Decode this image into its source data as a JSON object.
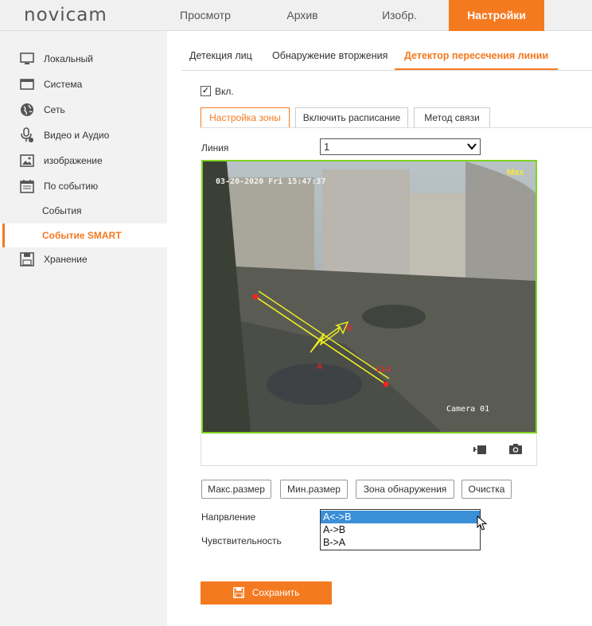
{
  "brand": {
    "logo": "novicam"
  },
  "topnav": [
    {
      "label": "Просмотр"
    },
    {
      "label": "Архив"
    },
    {
      "label": "Изобр."
    },
    {
      "label": "Настройки",
      "active": true
    }
  ],
  "sidebar": {
    "items": [
      {
        "label": "Локальный",
        "icon": "monitor-icon"
      },
      {
        "label": "Система",
        "icon": "window-icon"
      },
      {
        "label": "Сеть",
        "icon": "globe-icon"
      },
      {
        "label": "Видео и Аудио",
        "icon": "microphone-icon"
      },
      {
        "label": "изображение",
        "icon": "picture-icon"
      },
      {
        "label": "По событию",
        "icon": "calendar-icon"
      },
      {
        "label": "События"
      },
      {
        "label": "Событие SMART",
        "active": true
      },
      {
        "label": "Хранение",
        "icon": "floppy-icon"
      }
    ]
  },
  "tabs": [
    {
      "label": "Детекция лиц"
    },
    {
      "label": "Обнаружение вторжения"
    },
    {
      "label": "Детектор пересечения линии",
      "active": true
    }
  ],
  "enable": {
    "label": "Вкл.",
    "checked": true
  },
  "subtabs": [
    {
      "label": "Настройка зоны",
      "active": true
    },
    {
      "label": "Включить расписание"
    },
    {
      "label": "Метод связи"
    }
  ],
  "line": {
    "label": "Линия",
    "value": "1"
  },
  "video": {
    "timestamp": "03-20-2020 Fri 15:47:37",
    "camera_name": "Camera 01",
    "corner_label": "Max",
    "line_label": "L1-1",
    "side_a": "A",
    "side_b": "B"
  },
  "video_controls": [
    {
      "icon": "record-icon"
    },
    {
      "icon": "camera-icon"
    }
  ],
  "buttons": {
    "max_size": "Макс.размер",
    "min_size": "Мин.размер",
    "detection_zone": "Зона обнаружения",
    "clear": "Очистка"
  },
  "direction": {
    "label": "Напрвление",
    "options": [
      "A<->B",
      "A->B",
      "B->A"
    ],
    "selected": "A<->B"
  },
  "sensitivity": {
    "label": "Чувствительность"
  },
  "save": {
    "label": "Сохранить"
  },
  "colors": {
    "accent": "#f47a20",
    "zone_border": "#7ed321",
    "selection": "#3b8fd6"
  }
}
